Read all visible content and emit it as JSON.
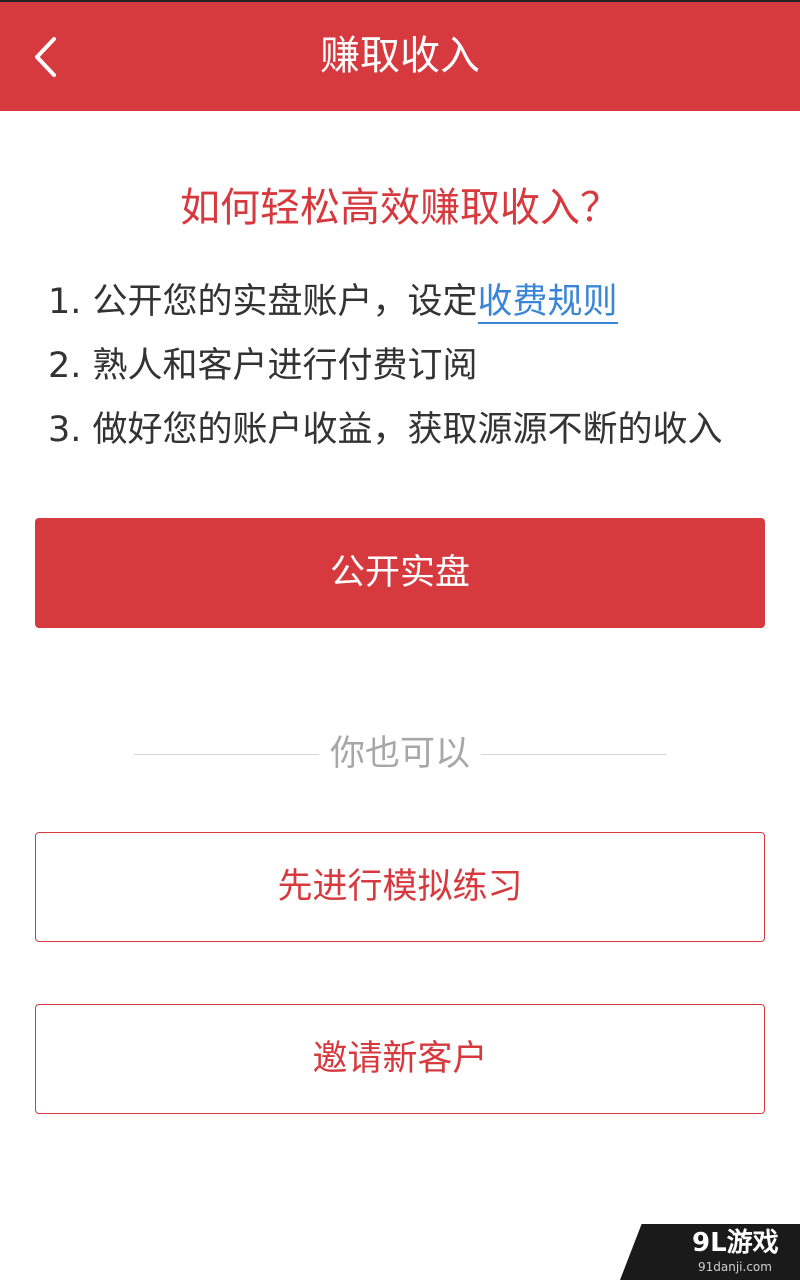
{
  "header": {
    "title": "赚取收入",
    "back_icon": "chevron-left-icon"
  },
  "intro": {
    "question": "如何轻松高效赚取收入？",
    "steps": [
      {
        "text": "1. 公开您的实盘账户，设定",
        "link": "收费规则"
      },
      {
        "text": "2. 熟人和客户进行付费订阅"
      },
      {
        "text": "3. 做好您的账户收益，获取源源不断的收入"
      }
    ]
  },
  "primary_button": {
    "label": "公开实盘"
  },
  "divider": {
    "label": "你也可以"
  },
  "secondary_buttons": [
    {
      "label": "先进行模拟练习"
    },
    {
      "label": "邀请新客户"
    }
  ],
  "watermark": {
    "brand": "9L游戏",
    "url": "91danji.com"
  },
  "colors": {
    "accent": "#d63a3f",
    "link": "#3a86d6",
    "text": "#333333",
    "muted": "#a7a7a7"
  }
}
